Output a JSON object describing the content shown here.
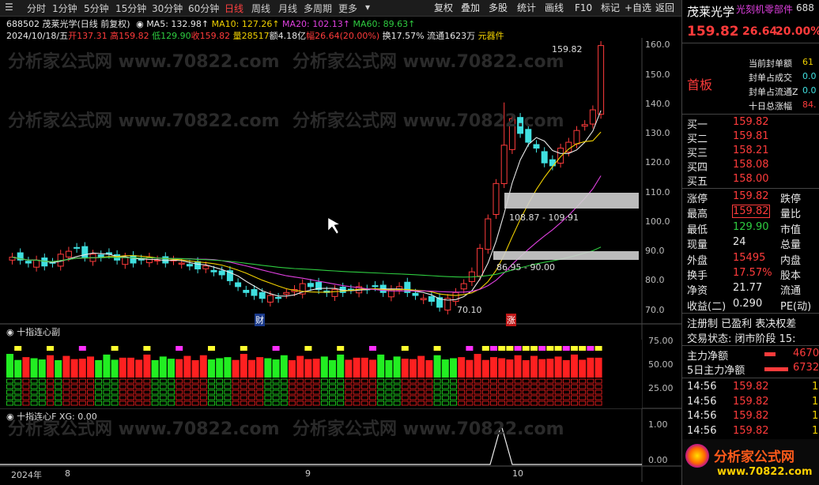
{
  "toolbar": {
    "periods": [
      "分时",
      "1分钟",
      "5分钟",
      "15分钟",
      "30分钟",
      "60分钟",
      "日线",
      "周线",
      "月线",
      "多周期",
      "更多"
    ],
    "active": "日线",
    "right": [
      "复权",
      "叠加",
      "多股",
      "统计",
      "画线",
      "F10",
      "标记",
      "+自选",
      "返回"
    ]
  },
  "info": {
    "code_name": "688502 茂莱光学(日线 前复权)",
    "ma5": "MA5: 132.98↑",
    "ma10": "MA10: 127.26↑",
    "ma20": "MA20: 102.13↑",
    "ma60": "MA60: 89.63↑",
    "date": "2024/10/18/五",
    "open": "开137.31",
    "high": "高159.82",
    "low": "低129.90",
    "close": "收159.82",
    "vol": "量28517",
    "amount": "额4.18亿",
    "range": "幅26.64(20.00%)",
    "turnover": "换17.57%",
    "float": "流通1623万",
    "sector": "元器件"
  },
  "chart": {
    "price_labels": [
      "160.0",
      "150.0",
      "140.0",
      "130.0",
      "120.0",
      "110.0",
      "100.0",
      "90.0",
      "80.0",
      "70.0"
    ],
    "annot_high": "159.82",
    "annot_low": "70.10",
    "band1": "108.87 - 109.91",
    "band2": "86.95 - 90.00",
    "marker_cai": "财",
    "marker_zhang": "涨",
    "sub1_title": "十指连心副",
    "sub1_axis": [
      "75.00",
      "50.00",
      "25.00"
    ],
    "sub2_title": "十指连心F  XG: 0.00",
    "sub2_axis": [
      "1.00",
      "0.00"
    ],
    "x_labels": [
      "2024年",
      "8",
      "9",
      "10"
    ],
    "watermark": "分析家公式网 www.70822.com"
  },
  "panel": {
    "name": "茂莱光学",
    "sector": "光刻机零部件",
    "code": "688",
    "price": "159.82",
    "change": "26.64",
    "pct": "20.00%",
    "status": "首板",
    "stats": [
      [
        "当前封单额",
        "61"
      ],
      [
        "封单占成交",
        "0.0"
      ],
      [
        "封单占流通Z",
        "0.0"
      ],
      [
        "十日总涨幅",
        "84."
      ]
    ],
    "bids": [
      [
        "买一",
        "159.82"
      ],
      [
        "买二",
        "159.81"
      ],
      [
        "买三",
        "158.21"
      ],
      [
        "买四",
        "158.08"
      ],
      [
        "买五",
        "158.00"
      ]
    ],
    "quote": [
      [
        "涨停",
        "159.82",
        "跌停"
      ],
      [
        "最高",
        "159.82",
        "量比"
      ],
      [
        "最低",
        "129.90",
        "市值"
      ],
      [
        "现量",
        "24",
        "总量"
      ],
      [
        "外盘",
        "15495",
        "内盘"
      ],
      [
        "换手",
        "17.57%",
        "股本"
      ],
      [
        "净资",
        "21.77",
        "流通"
      ],
      [
        "收益(二)",
        "0.290",
        "PE(动)"
      ]
    ],
    "tags": "注册制 已盈利 表决权差",
    "trade_state": "交易状态: 闭市阶段 15:",
    "flow": [
      [
        "主力净额",
        "4670"
      ],
      [
        "5日主力净额",
        "6732"
      ]
    ],
    "ticks": [
      [
        "14:56",
        "159.82",
        "1"
      ],
      [
        "14:56",
        "159.82",
        "1"
      ],
      [
        "14:56",
        "159.82",
        "1"
      ],
      [
        "14:56",
        "159.82",
        "1"
      ]
    ],
    "logo_cn": "分析家公式网",
    "logo_url": "www.70822.com"
  }
}
